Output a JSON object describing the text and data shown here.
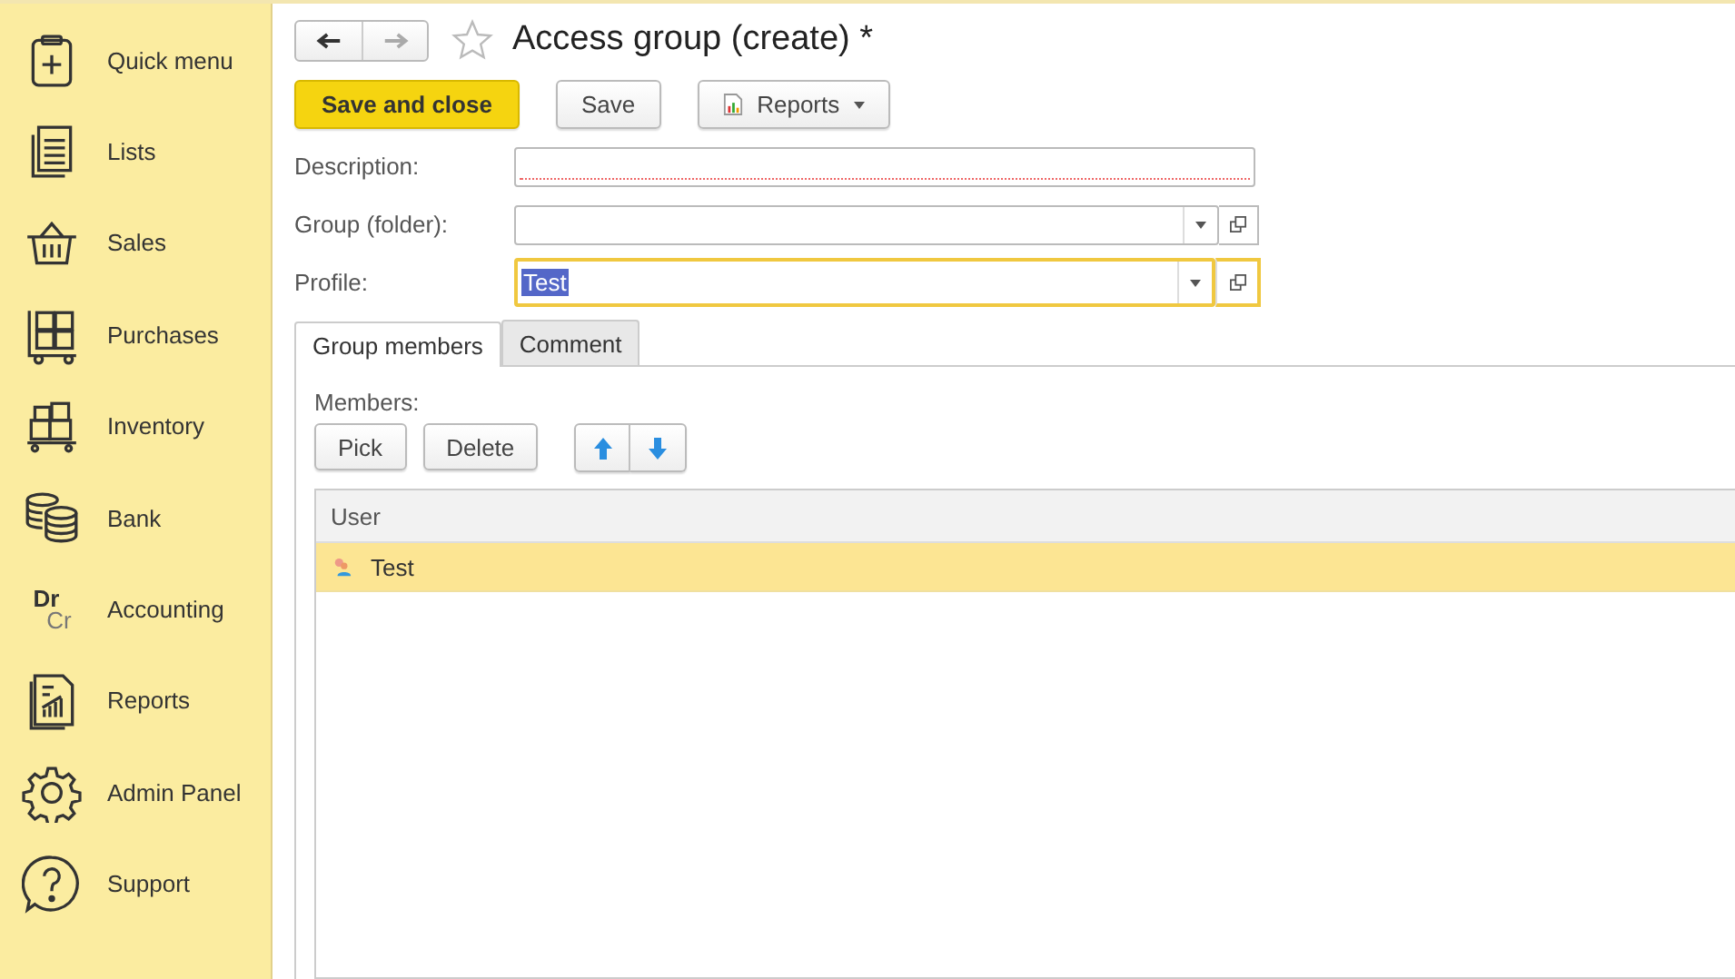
{
  "sidebar": {
    "items": [
      {
        "label": "Quick menu"
      },
      {
        "label": "Lists"
      },
      {
        "label": "Sales"
      },
      {
        "label": "Purchases"
      },
      {
        "label": "Inventory"
      },
      {
        "label": "Bank"
      },
      {
        "label": "Accounting",
        "icon_text": [
          "Dr",
          "Cr"
        ]
      },
      {
        "label": "Reports"
      },
      {
        "label": "Admin Panel"
      },
      {
        "label": "Support"
      }
    ]
  },
  "title": "Access group (create) *",
  "toolbar": {
    "save_close": "Save and close",
    "save": "Save",
    "reports": "Reports"
  },
  "fields": [
    {
      "label": "Description:",
      "dropdown": false,
      "focused": false,
      "required": true
    },
    {
      "label": "Group (folder):",
      "dropdown": true,
      "focused": false,
      "required": false
    },
    {
      "label": "Profile:",
      "value": "Test",
      "dropdown": true,
      "focused": true,
      "required": false
    }
  ],
  "tabs": [
    {
      "label": "Group members",
      "selected": true
    },
    {
      "label": "Comment",
      "selected": false
    }
  ],
  "members": {
    "label": "Members:",
    "buttons": [
      "Pick",
      "Delete"
    ],
    "table": {
      "columns": [
        "User"
      ],
      "rows": [
        {
          "user": "Test",
          "selected": true
        }
      ]
    }
  }
}
